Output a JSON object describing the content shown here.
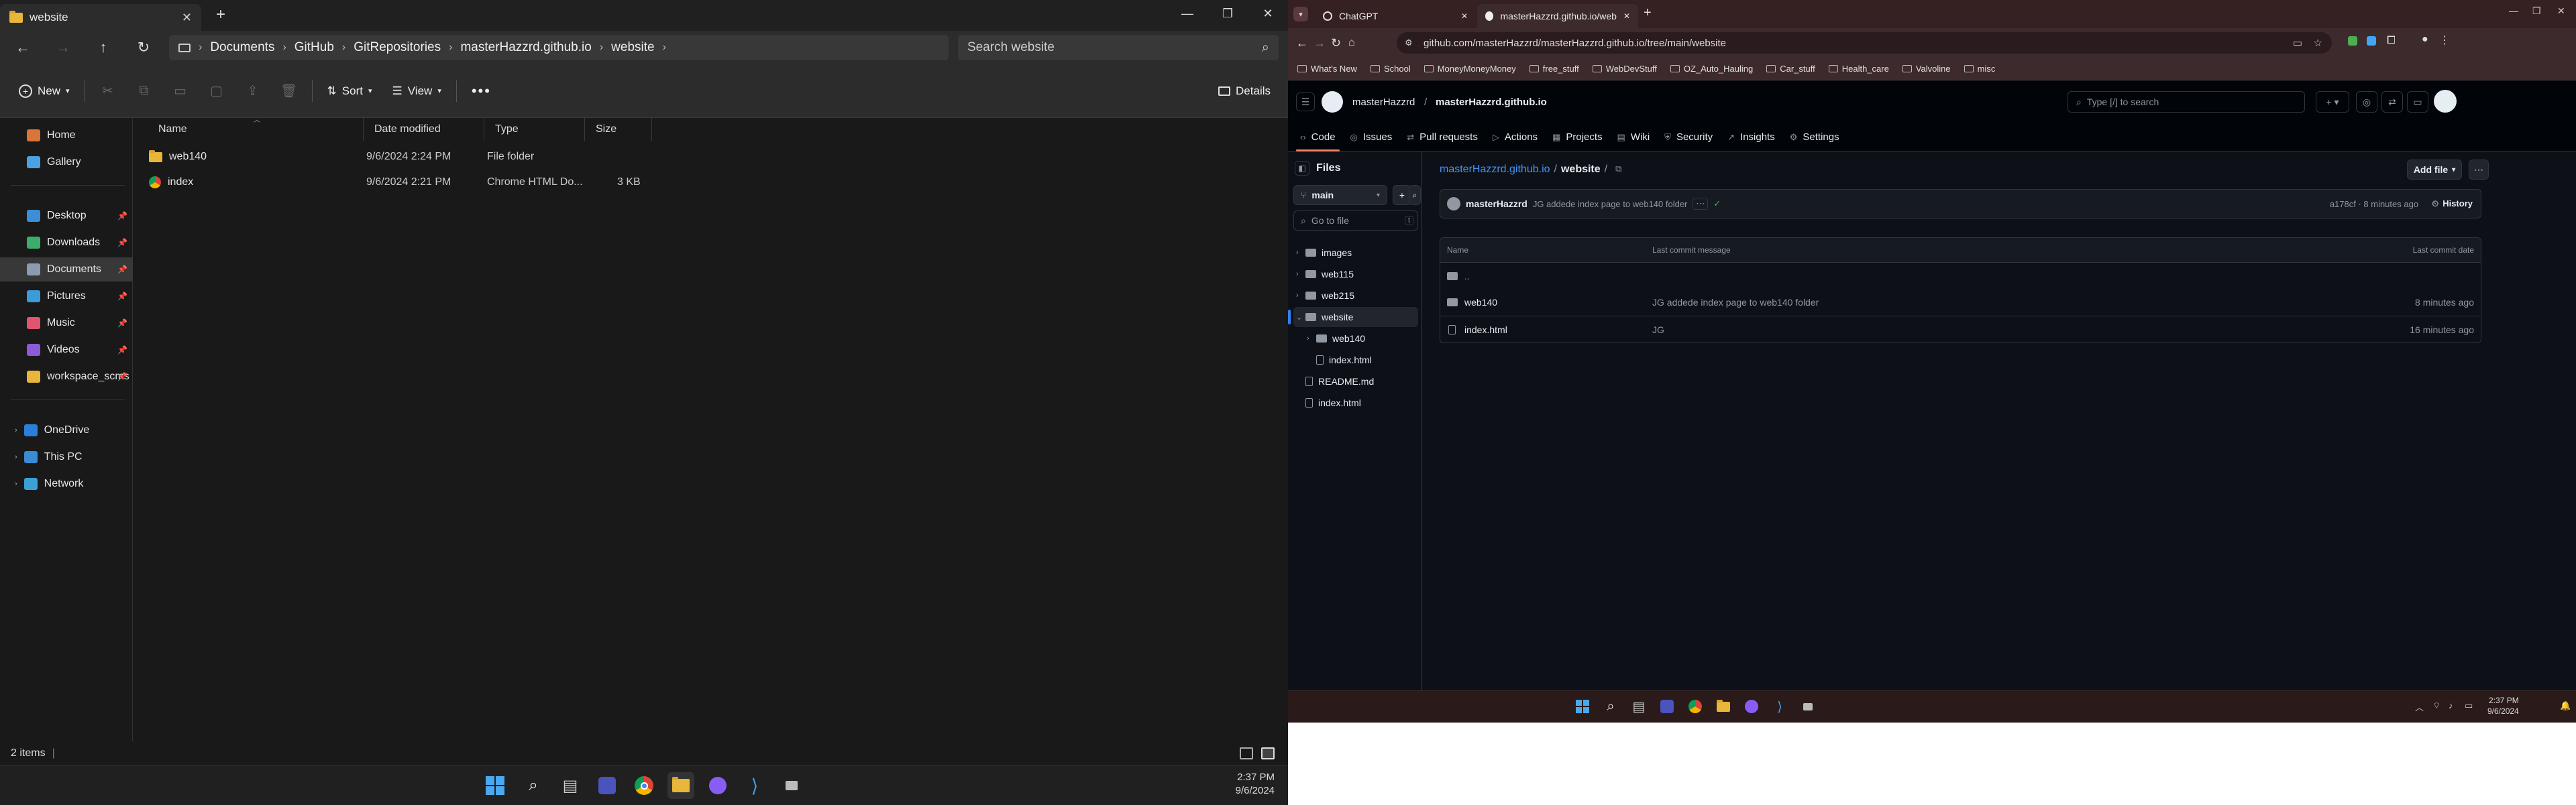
{
  "explorer": {
    "tab_title": "website",
    "breadcrumbs": [
      "Documents",
      "GitHub",
      "GitRepositories",
      "masterHazzrd.github.io",
      "website"
    ],
    "search_placeholder": "Search website",
    "toolbar": {
      "new": "New",
      "sort": "Sort",
      "view": "View",
      "details": "Details"
    },
    "sidebar": [
      {
        "label": "Home",
        "color": "#d9743a",
        "pinned": false
      },
      {
        "label": "Gallery",
        "color": "#4aa3e0",
        "pinned": false
      },
      {
        "label": "Desktop",
        "color": "#3b8ed8",
        "pinned": true
      },
      {
        "label": "Downloads",
        "color": "#3dac6b",
        "pinned": true
      },
      {
        "label": "Documents",
        "color": "#8c9bb0",
        "pinned": true
      },
      {
        "label": "Pictures",
        "color": "#3c9bd9",
        "pinned": true
      },
      {
        "label": "Music",
        "color": "#e05470",
        "pinned": true
      },
      {
        "label": "Videos",
        "color": "#8d5ad8",
        "pinned": true
      },
      {
        "label": "workspace_scms",
        "color": "#e8b63a",
        "pinned": true
      },
      {
        "label": "OneDrive",
        "color": "#2b7fd8",
        "pinned": false
      },
      {
        "label": "This PC",
        "color": "#3a8bd6",
        "pinned": false
      },
      {
        "label": "Network",
        "color": "#3aa0d6",
        "pinned": false
      }
    ],
    "columns": [
      "Name",
      "Date modified",
      "Type",
      "Size"
    ],
    "files": [
      {
        "name": "web140",
        "date": "9/6/2024 2:24 PM",
        "type": "File folder",
        "size": ""
      },
      {
        "name": "index",
        "date": "9/6/2024 2:21 PM",
        "type": "Chrome HTML Do...",
        "size": "3 KB"
      }
    ],
    "status": "2 items",
    "clock": {
      "time": "2:37 PM",
      "date": "9/6/2024"
    }
  },
  "browser": {
    "tabs": [
      "ChatGPT",
      "masterHazzrd.github.io/websi..."
    ],
    "url": "github.com/masterHazzrd/masterHazzrd.github.io/tree/main/website",
    "bookmarks": [
      "What's New",
      "School",
      "MoneyMoneyMoney",
      "free_stuff",
      "WebDevStuff",
      "OZ_Auto_Hauling",
      "Car_stuff",
      "Health_care",
      "Valvoline",
      "misc"
    ]
  },
  "github": {
    "owner": "masterHazzrd",
    "repo": "masterHazzrd.github.io",
    "search_placeholder": "Type [/] to search",
    "nav_tabs": [
      "Code",
      "Issues",
      "Pull requests",
      "Actions",
      "Projects",
      "Wiki",
      "Security",
      "Insights",
      "Settings"
    ],
    "files_heading": "Files",
    "branch": "main",
    "go_to_file": "Go to file",
    "tree": [
      {
        "name": "images",
        "kind": "dir",
        "indent": 0,
        "expanded": false
      },
      {
        "name": "web115",
        "kind": "dir",
        "indent": 0,
        "expanded": false
      },
      {
        "name": "web215",
        "kind": "dir",
        "indent": 0,
        "expanded": false
      },
      {
        "name": "website",
        "kind": "dir",
        "indent": 0,
        "expanded": true
      },
      {
        "name": "web140",
        "kind": "dir",
        "indent": 1,
        "expanded": false
      },
      {
        "name": "index.html",
        "kind": "file",
        "indent": 1,
        "expanded": false
      },
      {
        "name": "README.md",
        "kind": "file",
        "indent": 0,
        "expanded": false
      },
      {
        "name": "index.html",
        "kind": "file",
        "indent": 0,
        "expanded": false
      }
    ],
    "path_repo": "masterHazzrd.github.io",
    "path_folder": "website",
    "add_file": "Add file",
    "commit": {
      "author": "masterHazzrd",
      "message": "JG addede index page to web140 folder",
      "sha_time": "a178cf · 8 minutes ago",
      "history": "History"
    },
    "table_headers": [
      "Name",
      "Last commit message",
      "Last commit date"
    ],
    "parent_dir": "..",
    "rows": [
      {
        "name": "web140",
        "kind": "dir",
        "message": "JG addede index page to web140 folder",
        "date": "8 minutes ago"
      },
      {
        "name": "index.html",
        "kind": "file",
        "message": "JG",
        "date": "16 minutes ago"
      }
    ],
    "clock": {
      "time": "2:37 PM",
      "date": "9/6/2024"
    }
  }
}
